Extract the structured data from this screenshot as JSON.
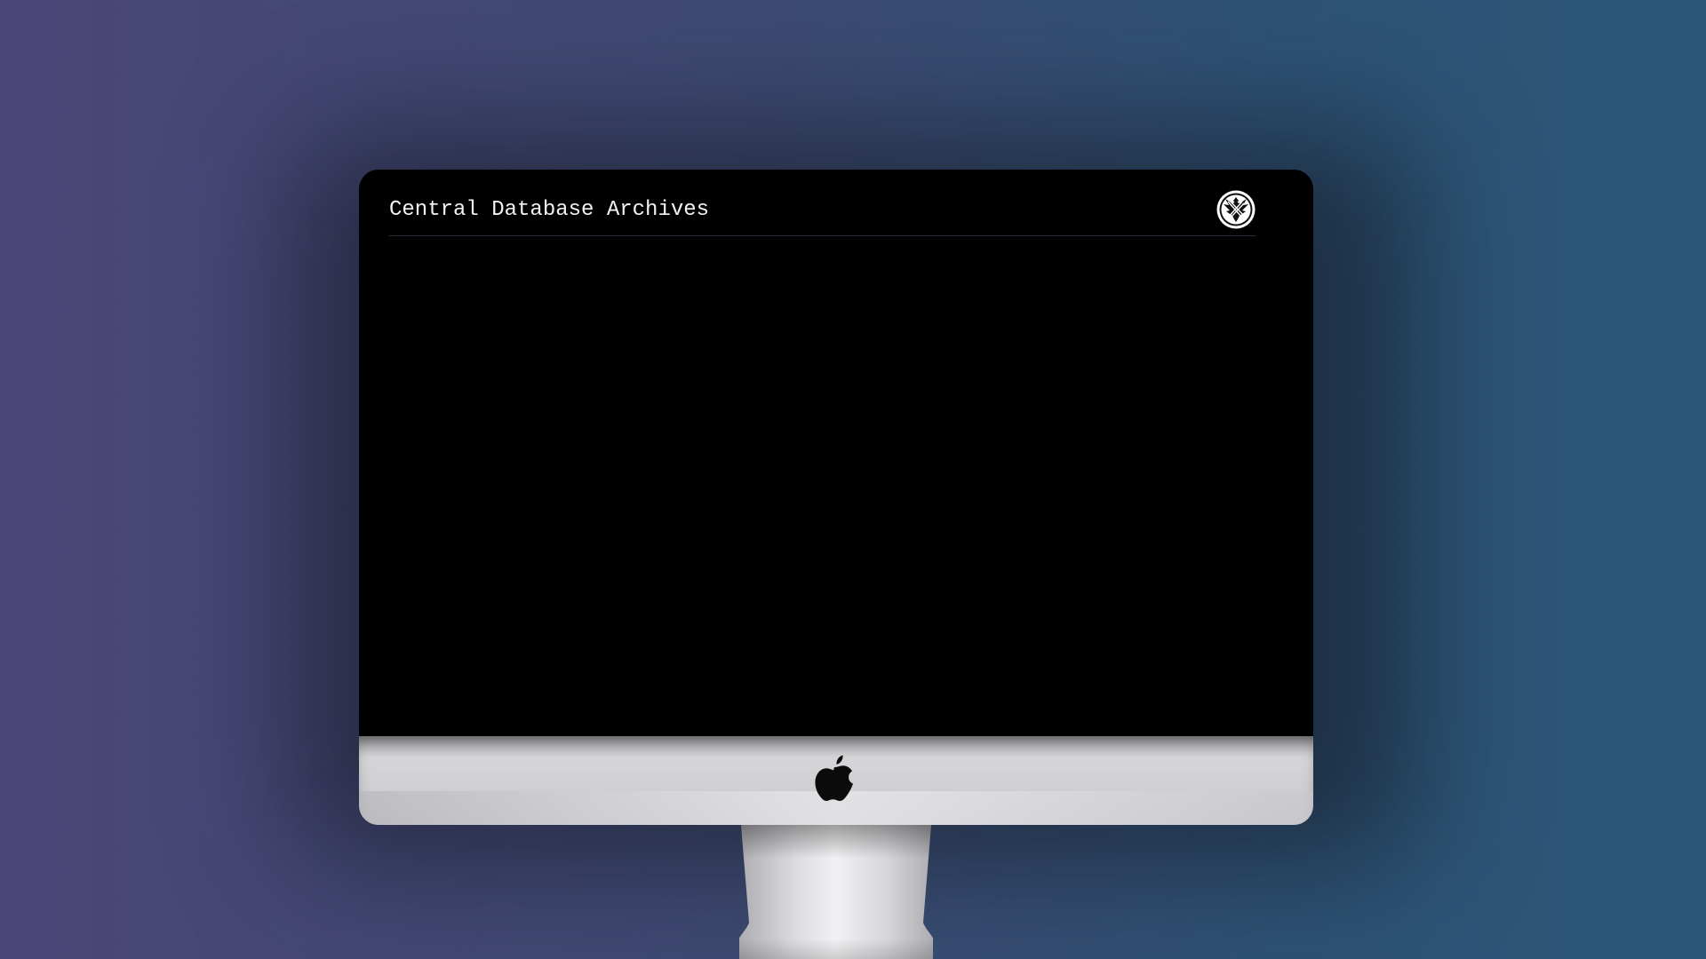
{
  "screen": {
    "title": "Central Database Archives",
    "logo_icon": "shield-eagle-icon"
  },
  "device": {
    "brand_icon": "apple-logo-icon",
    "screen_color": "#000000",
    "chin_color": "#cfcfd2"
  },
  "background": {
    "gradient_start": "#4b4677",
    "gradient_end": "#2b5778"
  }
}
